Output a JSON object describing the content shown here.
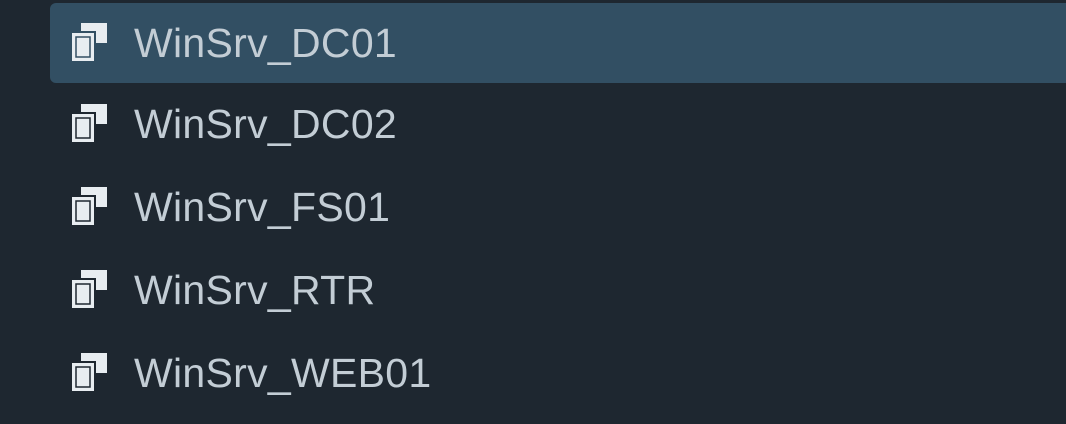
{
  "vm_list": {
    "items": [
      {
        "label": "WinSrv_DC01",
        "selected": true,
        "icon": "vm-group-icon"
      },
      {
        "label": "WinSrv_DC02",
        "selected": false,
        "icon": "vm-group-icon"
      },
      {
        "label": "WinSrv_FS01",
        "selected": false,
        "icon": "vm-group-icon"
      },
      {
        "label": "WinSrv_RTR",
        "selected": false,
        "icon": "vm-group-icon"
      },
      {
        "label": "WinSrv_WEB01",
        "selected": false,
        "icon": "vm-group-icon"
      }
    ]
  },
  "colors": {
    "background": "#1e2730",
    "selected_row": "#324f63",
    "label_text": "#c3cdd5",
    "icon_fill": "#e8edf1"
  }
}
